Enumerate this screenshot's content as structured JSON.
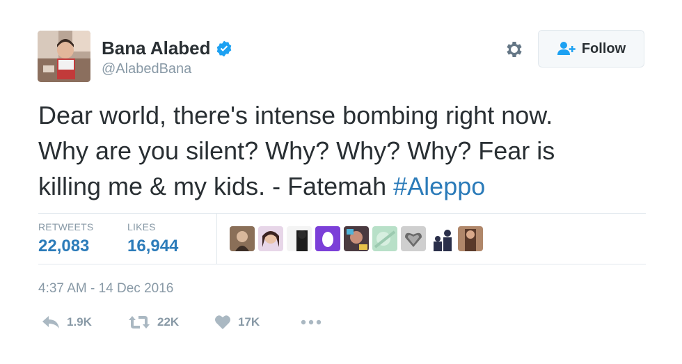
{
  "user": {
    "name": "Bana Alabed",
    "handle": "@AlabedBana"
  },
  "header": {
    "follow_label": "Follow"
  },
  "tweet": {
    "text_line1": "Dear world, there's intense bombing right now.",
    "text_line2": "Why are you silent? Why? Why? Why? Fear is",
    "text_line3_prefix": "killing me & my kids. - Fatemah ",
    "hashtag": "#Aleppo",
    "timestamp": "4:37 AM - 14 Dec 2016"
  },
  "stats": {
    "retweets_label": "RETWEETS",
    "retweets_value": "22,083",
    "likes_label": "LIKES",
    "likes_value": "16,944"
  },
  "actions": {
    "reply_count": "1.9K",
    "retweet_count": "22K",
    "like_count": "17K"
  },
  "colors": {
    "link": "#2b7bb9",
    "muted": "#8899a6",
    "verified": "#1da1f2"
  },
  "icons": [
    "verified-badge-icon",
    "gear-icon",
    "follow-person-icon",
    "reply-icon",
    "retweet-icon",
    "heart-icon",
    "more-icon"
  ]
}
